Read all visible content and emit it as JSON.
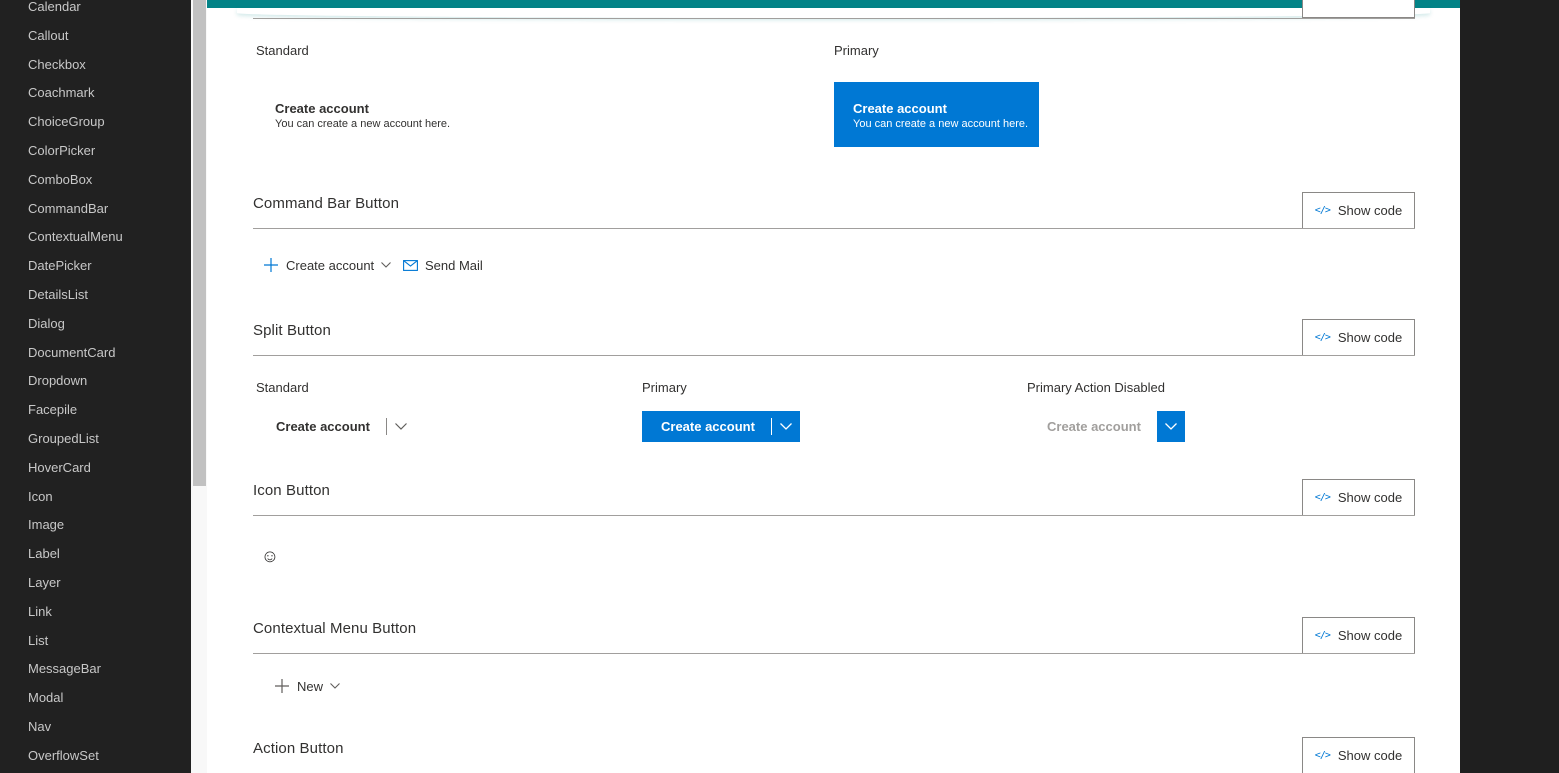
{
  "sidebar": {
    "items": [
      "Calendar",
      "Callout",
      "Checkbox",
      "Coachmark",
      "ChoiceGroup",
      "ColorPicker",
      "ComboBox",
      "CommandBar",
      "ContextualMenu",
      "DatePicker",
      "DetailsList",
      "Dialog",
      "DocumentCard",
      "Dropdown",
      "Facepile",
      "GroupedList",
      "HoverCard",
      "Icon",
      "Image",
      "Label",
      "Layer",
      "Link",
      "List",
      "MessageBar",
      "Modal",
      "Nav",
      "OverflowSet"
    ]
  },
  "colors": {
    "accent": "#0078d4",
    "teal": "#038387",
    "sidebar_bg": "#212121"
  },
  "compound": {
    "standard_label": "Standard",
    "primary_label": "Primary",
    "standard_button": {
      "title": "Create account",
      "subtitle": "You can create a new account here."
    },
    "primary_button": {
      "title": "Create account",
      "subtitle": "You can create a new account here."
    }
  },
  "command_bar": {
    "title": "Command Bar Button",
    "show_code": "Show code",
    "create_account": "Create account",
    "send_mail": "Send Mail"
  },
  "split": {
    "title": "Split Button",
    "show_code": "Show code",
    "standard_label": "Standard",
    "primary_label": "Primary",
    "disabled_label": "Primary Action Disabled",
    "standard_button": "Create account",
    "primary_button": "Create account",
    "disabled_button": "Create account"
  },
  "icon_button": {
    "title": "Icon Button",
    "show_code": "Show code",
    "icon": "☺"
  },
  "contextual_menu": {
    "title": "Contextual Menu Button",
    "show_code": "Show code",
    "new_label": "New"
  },
  "action_button": {
    "title": "Action Button",
    "show_code": "Show code"
  }
}
